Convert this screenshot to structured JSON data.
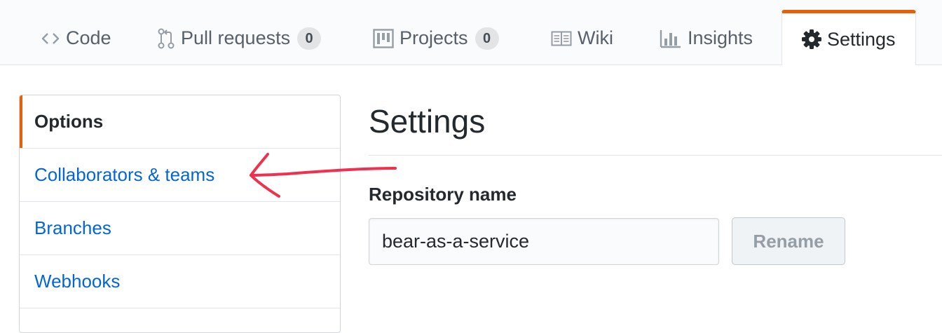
{
  "tabs": [
    {
      "label": "Code",
      "icon": "code-icon"
    },
    {
      "label": "Pull requests",
      "icon": "git-pull-request-icon",
      "count": "0"
    },
    {
      "label": "Projects",
      "icon": "project-icon",
      "count": "0"
    },
    {
      "label": "Wiki",
      "icon": "book-icon"
    },
    {
      "label": "Insights",
      "icon": "graph-icon"
    },
    {
      "label": "Settings",
      "icon": "gear-icon",
      "selected": true
    }
  ],
  "sidebar": {
    "items": [
      {
        "label": "Options",
        "selected": true
      },
      {
        "label": "Collaborators & teams"
      },
      {
        "label": "Branches"
      },
      {
        "label": "Webhooks"
      }
    ]
  },
  "main": {
    "title": "Settings",
    "repo_name_label": "Repository name",
    "repo_name_value": "bear-as-a-service",
    "rename_button": "Rename"
  },
  "colors": {
    "accent_orange": "#e36209",
    "link_blue": "#0366d6",
    "annotation_red": "#f0304f"
  }
}
